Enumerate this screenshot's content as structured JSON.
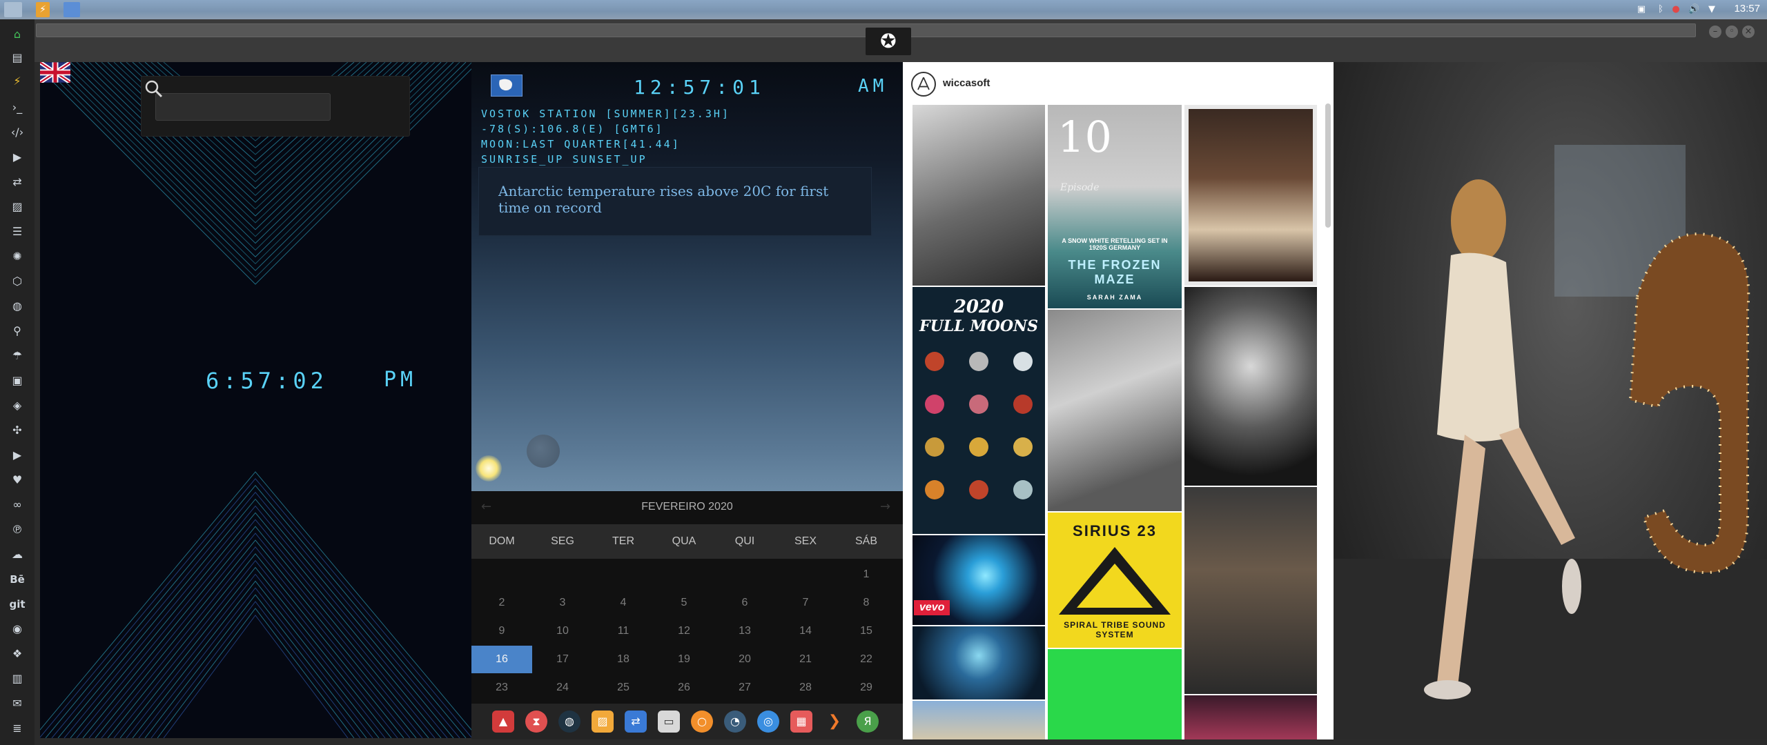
{
  "system_bar": {
    "clock": "13:57"
  },
  "uk_clock": {
    "search_placeholder": "",
    "time": "6:57:02",
    "ampm": "PM"
  },
  "antarctic": {
    "time": "12:57:01",
    "ampm": "AM",
    "info_lines": [
      "VOSTOK STATION [SUMMER][23.3H]",
      "-78(S):106.8(E) [GMT6]",
      "MOON:LAST QUARTER[41.44]",
      "SUNRISE_UP SUNSET_UP"
    ],
    "headline": "Antarctic temperature rises above 20C for first time on record"
  },
  "calendar": {
    "month": "FEVEREIRO 2020",
    "day_names": [
      "DOM",
      "SEG",
      "TER",
      "QUA",
      "QUI",
      "SEX",
      "SÁB"
    ],
    "weeks": [
      [
        "",
        "",
        "",
        "",
        "",
        "",
        "1"
      ],
      [
        "2",
        "3",
        "4",
        "5",
        "6",
        "7",
        "8"
      ],
      [
        "9",
        "10",
        "11",
        "12",
        "13",
        "14",
        "15"
      ],
      [
        "16",
        "17",
        "18",
        "19",
        "20",
        "21",
        "22"
      ],
      [
        "23",
        "24",
        "25",
        "26",
        "27",
        "28",
        "29"
      ]
    ],
    "today": "16",
    "accent_color": "#4a84c9"
  },
  "instagram": {
    "username": "wiccasoft",
    "tiles": {
      "frozen_maze_number": "10",
      "frozen_maze_episode": "Episode",
      "frozen_maze_tagline": "A SNOW WHITE RETELLING SET IN 1920S GERMANY",
      "frozen_maze_title": "THE FROZEN MAZE",
      "frozen_maze_author": "SARAH ZAMA",
      "moons_title_1": "2020",
      "moons_title_2": "FULL MOONS",
      "vevo": "vevo",
      "sirius_title": "SIRIUS 23",
      "sirius_sub": "SPIRAL TRIBE SOUND SYSTEM"
    }
  },
  "dock_icons": [
    "home-icon",
    "document-icon",
    "lightning-icon",
    "terminal-icon",
    "code-icon",
    "play-icon",
    "translate-icon",
    "image-icon",
    "news-icon",
    "settings-icon",
    "hexagon-icon",
    "globe-icon",
    "search-icon",
    "umbrella-icon",
    "contact-icon",
    "diamond-icon",
    "expand-icon",
    "youtube-icon",
    "heart-icon",
    "infinity-icon",
    "pinterest-icon",
    "cloud-icon",
    "behance-icon",
    "git-icon",
    "github-icon",
    "cubes-icon",
    "map-icon",
    "mail-icon",
    "list-icon"
  ],
  "dock_labels": {
    "behance": "Bē",
    "git": "git"
  }
}
